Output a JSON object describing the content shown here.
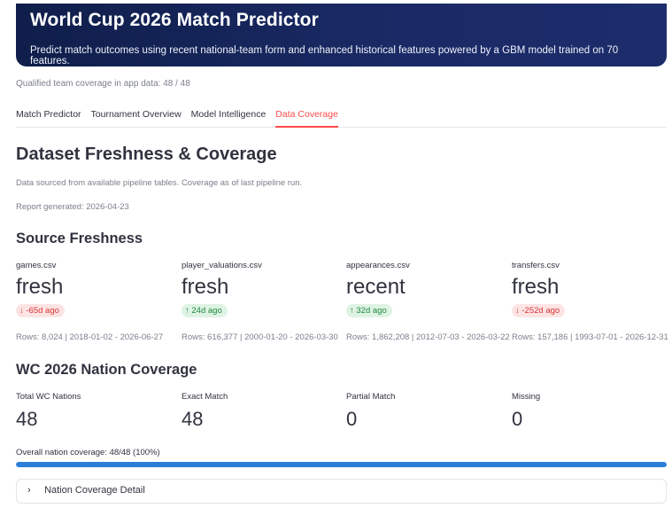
{
  "header": {
    "title": "World Cup 2026 Match Predictor",
    "subtitle": "Predict match outcomes using recent national-team form and enhanced historical features powered by a GBM model trained on 70 features."
  },
  "coverage_note": "Qualified team coverage in app data: 48 / 48",
  "tabs": [
    {
      "label": "Match Predictor"
    },
    {
      "label": "Tournament Overview"
    },
    {
      "label": "Model Intelligence"
    },
    {
      "label": "Data Coverage",
      "active": true
    }
  ],
  "page": {
    "title": "Dataset Freshness & Coverage",
    "source_note": "Data sourced from available pipeline tables. Coverage as of last pipeline run.",
    "report_generated": "Report generated: 2026-04-23"
  },
  "freshness": {
    "title": "Source Freshness",
    "sources": [
      {
        "file": "games.csv",
        "status": "fresh",
        "delta": "-65d ago",
        "direction": "down",
        "rows": "Rows: 8,024 | 2018-01-02 - 2026-06-27"
      },
      {
        "file": "player_valuations.csv",
        "status": "fresh",
        "delta": "24d ago",
        "direction": "up",
        "rows": "Rows: 616,377 | 2000-01-20 - 2026-03-30"
      },
      {
        "file": "appearances.csv",
        "status": "recent",
        "delta": "32d ago",
        "direction": "up",
        "rows": "Rows: 1,862,208 | 2012-07-03 - 2026-03-22"
      },
      {
        "file": "transfers.csv",
        "status": "fresh",
        "delta": "-252d ago",
        "direction": "down",
        "rows": "Rows: 157,186 | 1993-07-01 - 2026-12-31"
      }
    ]
  },
  "nation_coverage": {
    "title": "WC 2026 Nation Coverage",
    "metrics": [
      {
        "label": "Total WC Nations",
        "value": "48"
      },
      {
        "label": "Exact Match",
        "value": "48"
      },
      {
        "label": "Partial Match",
        "value": "0"
      },
      {
        "label": "Missing",
        "value": "0"
      }
    ],
    "overall_label": "Overall nation coverage: 48/48 (100%)",
    "overall_fraction": 1.0
  },
  "expander": {
    "label": "Nation Coverage Detail"
  },
  "colors": {
    "accent": "#ff4b4b",
    "progress": "#2b7fd6",
    "hero": "#1b2a66",
    "delta_neg": "#d93535",
    "delta_pos": "#1f8a3d"
  },
  "icons": {
    "arrow_down": "arrow-down-icon",
    "arrow_up": "arrow-up-icon",
    "chevron": "chevron-right-icon"
  }
}
